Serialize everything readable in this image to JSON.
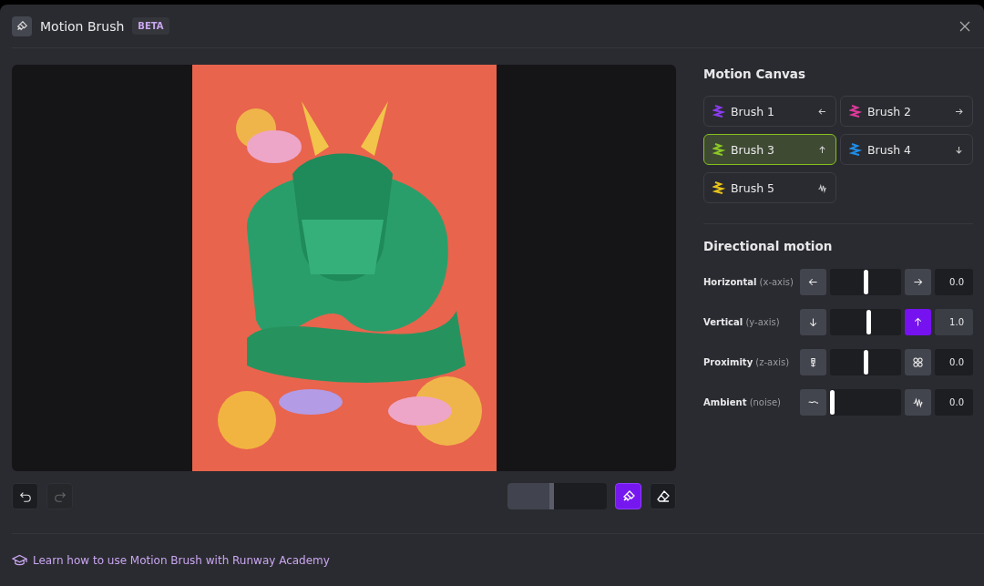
{
  "dialog": {
    "title": "Motion Brush",
    "badge": "BETA"
  },
  "toolbar": {
    "undo": {
      "disabled": false
    },
    "redo": {
      "disabled": true
    },
    "brush_size": {
      "level": 0.47
    },
    "tools": [
      {
        "kind": "brush",
        "selected": true
      },
      {
        "kind": "eraser",
        "selected": false
      }
    ]
  },
  "motion_canvas": {
    "title": "Motion Canvas",
    "brushes": [
      {
        "label": "Brush 1",
        "color": "#8b3cf0",
        "kind": "left",
        "selected": false
      },
      {
        "label": "Brush 2",
        "color": "#e0399b",
        "kind": "right",
        "selected": false
      },
      {
        "label": "Brush 3",
        "color": "#8bc926",
        "kind": "up",
        "selected": true
      },
      {
        "label": "Brush 4",
        "color": "#1f8ee8",
        "kind": "down",
        "selected": false
      },
      {
        "label": "Brush 5",
        "color": "#e8c41a",
        "kind": "noise",
        "selected": false
      }
    ]
  },
  "directional_motion": {
    "title": "Directional motion",
    "rows": [
      {
        "label": "Horizontal",
        "hint": "(x-axis)",
        "left_button": {
          "kind": "left",
          "active": false
        },
        "level": 0.5,
        "right_button": {
          "kind": "right",
          "active": false
        },
        "value": "0.0"
      },
      {
        "label": "Vertical",
        "hint": "(y-axis)",
        "left_button": {
          "kind": "down",
          "active": false
        },
        "level": 0.55,
        "right_button": {
          "kind": "up",
          "active": true
        },
        "value": "1.0"
      },
      {
        "label": "Proximity",
        "hint": "(z-axis)",
        "left_button": {
          "kind": "small",
          "active": false
        },
        "level": 0.5,
        "right_button": {
          "kind": "big",
          "active": false
        },
        "value": "0.0"
      },
      {
        "label": "Ambient",
        "hint": "(noise)",
        "left_button": {
          "kind": "calm",
          "active": false
        },
        "level": 0.0,
        "right_button": {
          "kind": "noise",
          "active": false
        },
        "value": "0.0"
      }
    ]
  },
  "footer": {
    "link": "Learn how to use Motion Brush with Runway Academy"
  }
}
